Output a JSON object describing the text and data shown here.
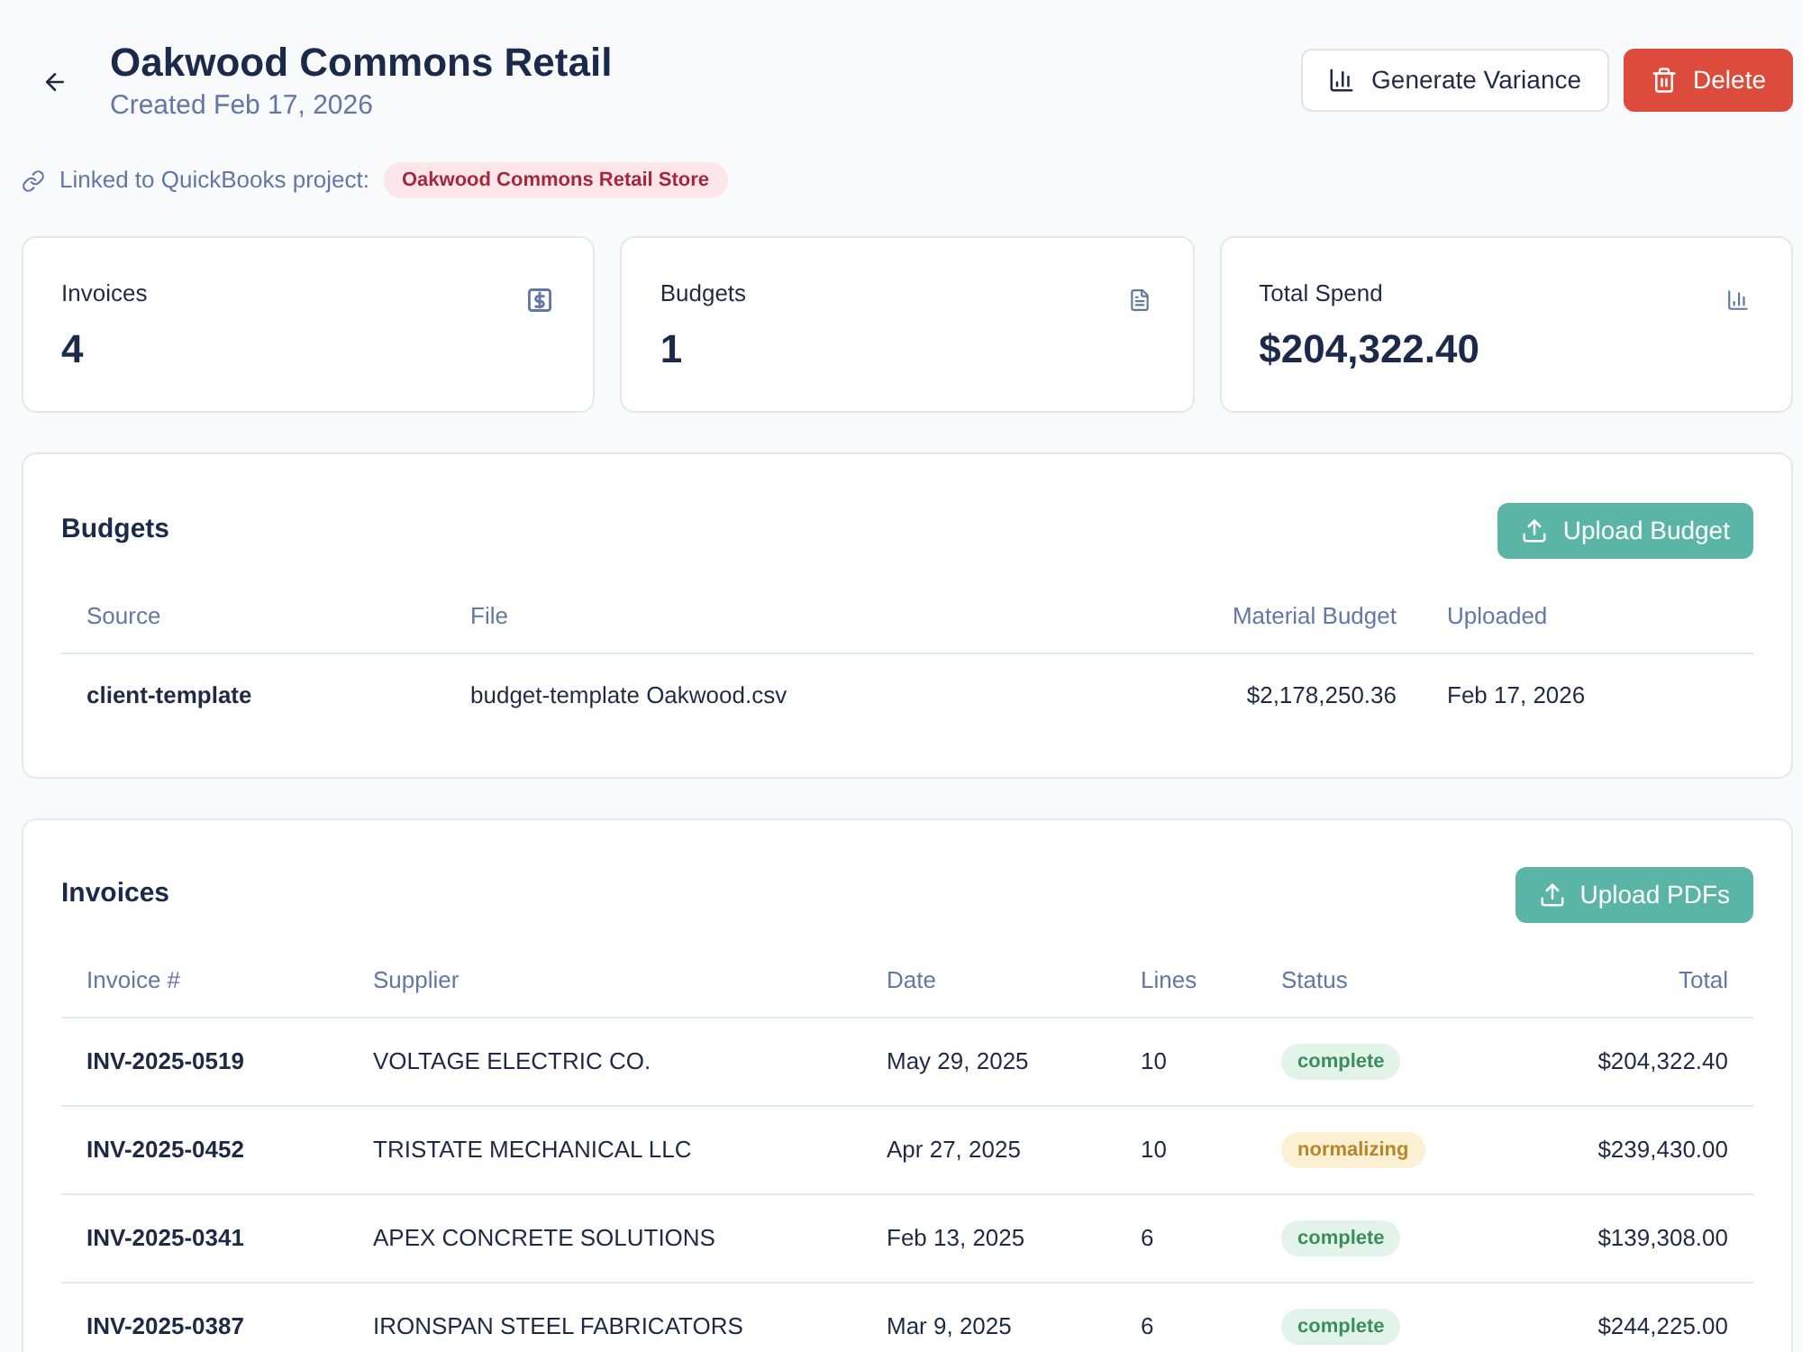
{
  "header": {
    "title": "Oakwood Commons Retail",
    "subtitle": "Created Feb 17, 2026"
  },
  "actions": [
    {
      "label": "Generate Variance",
      "kind": "secondary"
    },
    {
      "label": "Delete",
      "kind": "danger"
    }
  ],
  "link": {
    "label": "Linked to QuickBooks project:",
    "project": "Oakwood Commons Retail Store"
  },
  "stats": [
    {
      "label": "Invoices",
      "value": "4",
      "kind": "invoices"
    },
    {
      "label": "Budgets",
      "value": "1",
      "kind": "budgets"
    },
    {
      "label": "Total Spend",
      "value": "$204,322.40",
      "kind": "spend"
    }
  ],
  "budgets": {
    "title": "Budgets",
    "upload_button": "Upload Budget",
    "columns": [
      "Source",
      "File",
      "Material Budget",
      "Uploaded"
    ],
    "rows": [
      [
        "client-template",
        "budget-template Oakwood.csv",
        "$2,178,250.36",
        "Feb 17, 2026"
      ]
    ]
  },
  "invoices": {
    "title": "Invoices",
    "upload_button": "Upload PDFs",
    "columns": [
      "Invoice #",
      "Supplier",
      "Date",
      "Lines",
      "Status",
      "Total"
    ],
    "rows": [
      {
        "invoice": "INV-2025-0519",
        "supplier": "VOLTAGE ELECTRIC CO.",
        "date": "May 29, 2025",
        "lines": "10",
        "status": {
          "label": "complete",
          "kind": "done"
        },
        "total": "$204,322.40"
      },
      {
        "invoice": "INV-2025-0452",
        "supplier": "TRISTATE MECHANICAL LLC",
        "date": "Apr 27, 2025",
        "lines": "10",
        "status": {
          "label": "normalizing",
          "kind": "processing"
        },
        "total": "$239,430.00"
      },
      {
        "invoice": "INV-2025-0341",
        "supplier": "APEX CONCRETE SOLUTIONS",
        "date": "Feb 13, 2025",
        "lines": "6",
        "status": {
          "label": "complete",
          "kind": "done"
        },
        "total": "$139,308.00"
      },
      {
        "invoice": "INV-2025-0387",
        "supplier": "IRONSPAN STEEL FABRICATORS",
        "date": "Mar 9, 2025",
        "lines": "6",
        "status": {
          "label": "complete",
          "kind": "done"
        },
        "total": "$244,225.00"
      }
    ]
  }
}
